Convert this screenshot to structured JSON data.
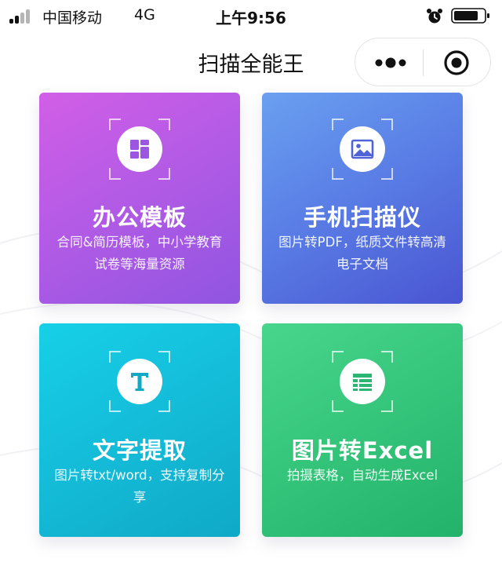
{
  "status_bar": {
    "carrier": "中国移动",
    "network": "4G",
    "time": "上午9:56",
    "icons": [
      "signal-icon",
      "alarm-icon",
      "battery-icon"
    ]
  },
  "nav": {
    "title": "扫描全能王",
    "capsule_icons": [
      "more-icon",
      "close-icon"
    ]
  },
  "cards": [
    {
      "title": "办公模板",
      "description": "合同&简历模板，中小学教育试卷等海量资源",
      "icon": "template-grid-icon",
      "color": "#b45be6"
    },
    {
      "title": "手机扫描仪",
      "description": "图片转PDF，纸质文件转高清电子文档",
      "icon": "image-icon",
      "color": "#5a7fe6"
    },
    {
      "title": "文字提取",
      "description": "图片转txt/word，支持复制分享",
      "icon": "text-t-icon",
      "color": "#14bcd8"
    },
    {
      "title": "图片转Excel",
      "description": "拍摄表格，自动生成Excel",
      "icon": "table-icon",
      "color": "#34c47a"
    }
  ]
}
